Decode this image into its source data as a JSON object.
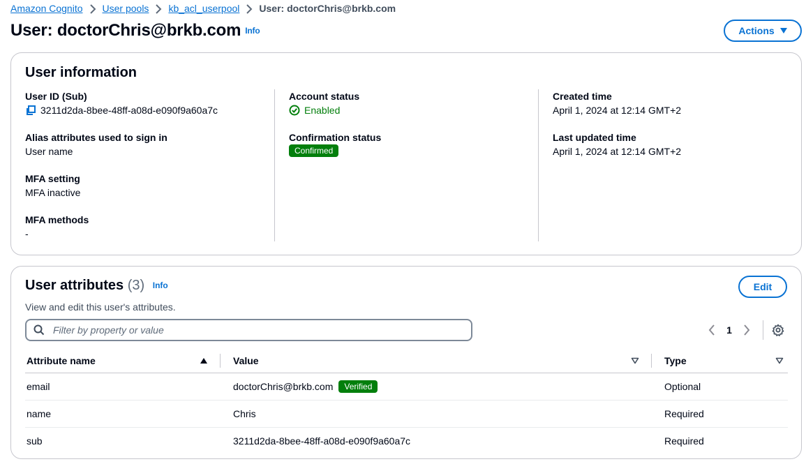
{
  "breadcrumb": {
    "items": [
      "Amazon Cognito",
      "User pools",
      "kb_acl_userpool"
    ],
    "current": "User: doctorChris@brkb.com"
  },
  "header": {
    "title": "User: doctorChris@brkb.com",
    "info": "Info",
    "actions_label": "Actions"
  },
  "user_info": {
    "title": "User information",
    "user_id_label": "User ID (Sub)",
    "user_id_value": "3211d2da-8bee-48ff-a08d-e090f9a60a7c",
    "alias_label": "Alias attributes used to sign in",
    "alias_value": "User name",
    "mfa_setting_label": "MFA setting",
    "mfa_setting_value": "MFA inactive",
    "mfa_methods_label": "MFA methods",
    "mfa_methods_value": "-",
    "account_status_label": "Account status",
    "account_status_value": "Enabled",
    "confirmation_status_label": "Confirmation status",
    "confirmation_status_value": "Confirmed",
    "created_label": "Created time",
    "created_value": "April 1, 2024 at 12:14 GMT+2",
    "updated_label": "Last updated time",
    "updated_value": "April 1, 2024 at 12:14 GMT+2"
  },
  "attributes": {
    "title": "User attributes",
    "count": "(3)",
    "info": "Info",
    "description": "View and edit this user's attributes.",
    "edit_label": "Edit",
    "filter_placeholder": "Filter by property or value",
    "page": "1",
    "columns": [
      "Attribute name",
      "Value",
      "Type"
    ],
    "rows": [
      {
        "name": "email",
        "value": "doctorChris@brkb.com",
        "badge": "Verified",
        "type": "Optional"
      },
      {
        "name": "name",
        "value": "Chris",
        "badge": "",
        "type": "Required"
      },
      {
        "name": "sub",
        "value": "3211d2da-8bee-48ff-a08d-e090f9a60a7c",
        "badge": "",
        "type": "Required"
      }
    ]
  },
  "colors": {
    "link": "#0972d3",
    "success": "#037f0c",
    "border": "#c6c6cd"
  }
}
